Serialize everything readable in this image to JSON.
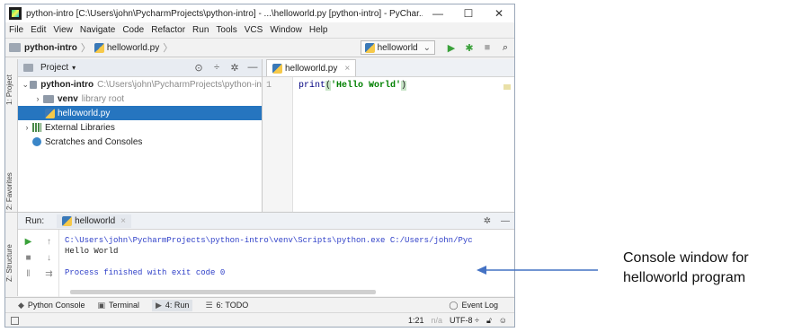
{
  "window": {
    "title": "python-intro [C:\\Users\\john\\PycharmProjects\\python-intro] - ...\\helloworld.py [python-intro] - PyChar...",
    "controls": {
      "minimize": "—",
      "maximize": "☐",
      "close": "✕"
    }
  },
  "menu": [
    "File",
    "Edit",
    "View",
    "Navigate",
    "Code",
    "Refactor",
    "Run",
    "Tools",
    "VCS",
    "Window",
    "Help"
  ],
  "navbar": {
    "breadcrumbs": [
      "python-intro",
      "helloworld.py"
    ],
    "run_config": "helloworld"
  },
  "sidebar_left": {
    "project_tab": "1: Project",
    "favorites_tab": "2: Favorites",
    "structure_tab": "Z: Structure"
  },
  "project": {
    "header": "Project",
    "tree": [
      {
        "label": "python-intro",
        "detail": "C:\\Users\\john\\PycharmProjects\\python-in"
      },
      {
        "label": "venv",
        "detail": "library root"
      },
      {
        "label": "helloworld.py"
      },
      {
        "label": "External Libraries"
      },
      {
        "label": "Scratches and Consoles"
      }
    ]
  },
  "editor": {
    "tab": "helloworld.py",
    "line_number": "1",
    "code": {
      "keyword": "print",
      "open": "(",
      "string": "'Hello World'",
      "close": ")"
    }
  },
  "run": {
    "label": "Run:",
    "tab": "helloworld",
    "console": {
      "command": "C:\\Users\\john\\PycharmProjects\\python-intro\\venv\\Scripts\\python.exe C:/Users/john/Pyc",
      "output": "Hello World",
      "finished": "Process finished with exit code 0"
    }
  },
  "bottom_tabs": {
    "python_console": "Python Console",
    "terminal": "Terminal",
    "run": "4: Run",
    "todo": "6: TODO",
    "event_log": "Event Log"
  },
  "status": {
    "position": "1:21",
    "na": "n/a",
    "encoding": "UTF-8 ÷"
  },
  "annotation": {
    "line1": "Console window for",
    "line2": "helloworld program",
    "arrow_color": "#4472c4"
  },
  "colors": {
    "selection": "#2675bf",
    "run_green": "#3aa13a",
    "console_blue": "#2e3fc8"
  }
}
